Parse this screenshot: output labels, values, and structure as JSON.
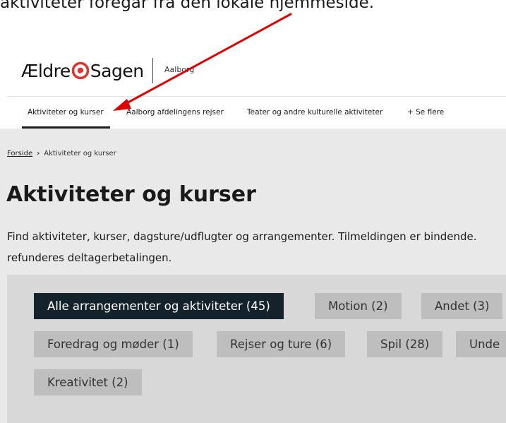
{
  "caption": "aktiviteter foregår fra den lokale hjemmeside.",
  "header": {
    "logo_left": "Ældre",
    "logo_right": "Sagen",
    "region": "Aalborg"
  },
  "nav": {
    "items": [
      {
        "label": "Aktiviteter og kurser"
      },
      {
        "label": "Aalborg afdelingens rejser"
      },
      {
        "label": "Teater og andre kulturelle aktiviteter"
      },
      {
        "label": "+ Se flere"
      }
    ]
  },
  "breadcrumb": {
    "home": "Forside",
    "separator": "›",
    "current": "Aktiviteter og kurser"
  },
  "page": {
    "title": "Aktiviteter og kurser",
    "intro_line1": "Find aktiviteter, kurser, dagsture/udflugter og arrangementer. Tilmeldingen er bindende.",
    "intro_line2": "refunderes deltagerbetalingen."
  },
  "filters": [
    {
      "label": "Alle arrangementer og aktiviteter (45)"
    },
    {
      "label": "Motion (2)"
    },
    {
      "label": "Andet (3)"
    },
    {
      "label": "Foredrag og møder (1)"
    },
    {
      "label": "Rejser og ture (6)"
    },
    {
      "label": "Spil (28)"
    },
    {
      "label": "Unde"
    },
    {
      "label": "Kreativitet (2)"
    }
  ],
  "colors": {
    "brand_red": "#e3312e",
    "active_chip": "#14232b",
    "arrow": "#e00000"
  }
}
